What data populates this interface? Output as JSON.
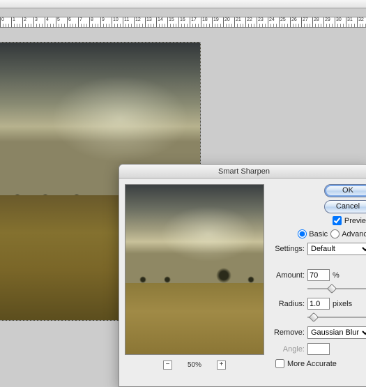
{
  "ruler": {
    "start": 0,
    "major_step": 1,
    "count": 30
  },
  "dialog": {
    "title": "Smart Sharpen",
    "ok": "OK",
    "cancel": "Cancel",
    "preview_label": "Preview",
    "preview_checked": true,
    "mode": {
      "basic": "Basic",
      "advanced": "Advance",
      "selected": "basic"
    },
    "settings_label": "Settings:",
    "settings_value": "Default",
    "amount_label": "Amount:",
    "amount_value": "70",
    "amount_unit": "%",
    "radius_label": "Radius:",
    "radius_value": "1.0",
    "radius_unit": "pixels",
    "remove_label": "Remove:",
    "remove_value": "Gaussian Blur",
    "angle_label": "Angle:",
    "angle_value": "",
    "more_accurate_label": "More Accurate",
    "more_accurate_checked": false,
    "zoom": {
      "minus": "−",
      "plus": "+",
      "level": "50%"
    }
  }
}
